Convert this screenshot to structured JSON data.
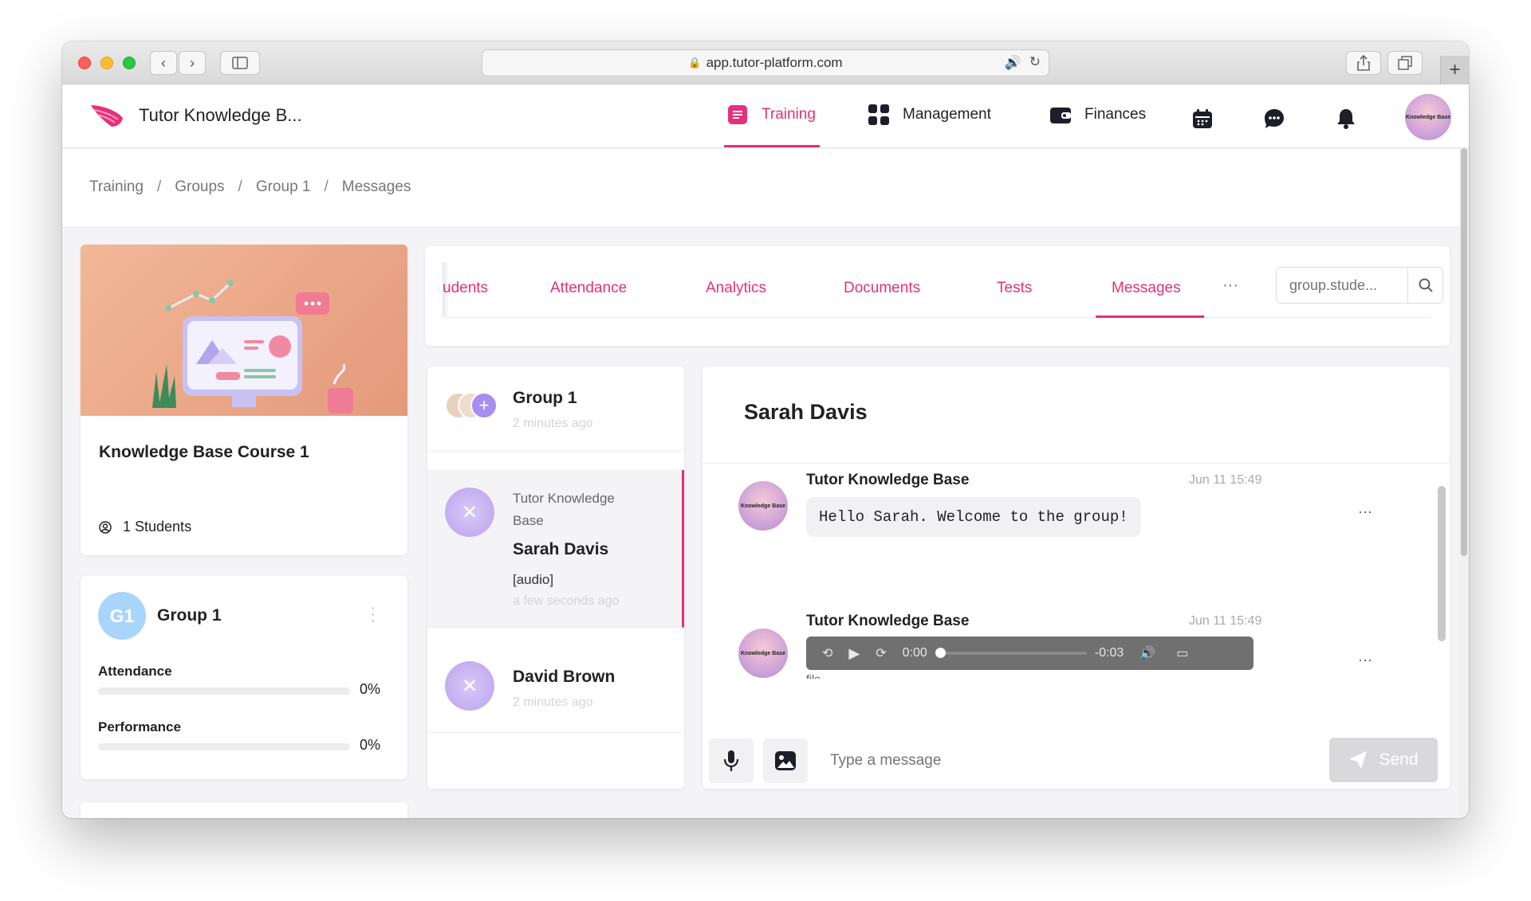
{
  "browser": {
    "url": "app.tutor-platform.com"
  },
  "header": {
    "app_name": "Tutor Knowledge B...",
    "nav": [
      {
        "label": "Training",
        "active": true
      },
      {
        "label": "Management",
        "active": false
      },
      {
        "label": "Finances",
        "active": false
      }
    ],
    "icons": [
      "calendar-icon",
      "chat-icon",
      "bell-icon"
    ],
    "avatar_text": "Knowledge Base"
  },
  "breadcrumb": [
    "Training",
    "Groups",
    "Group 1",
    "Messages"
  ],
  "course": {
    "title": "Knowledge Base Course 1",
    "students": "1 Students"
  },
  "group": {
    "badge": "G1",
    "name": "Group 1",
    "metrics": [
      {
        "label": "Attendance",
        "value": "0%",
        "fraction": 0
      },
      {
        "label": "Performance",
        "value": "0%",
        "fraction": 0
      }
    ]
  },
  "tabs": {
    "items": [
      "udents",
      "Attendance",
      "Analytics",
      "Documents",
      "Tests",
      "Messages"
    ],
    "active": "Messages",
    "more": "···",
    "search_placeholder": "group.stude..."
  },
  "conversations": [
    {
      "name": "Group 1",
      "time": "2 minutes ago",
      "selected": false
    },
    {
      "sender": "Tutor Knowledge Base",
      "name": "Sarah Davis",
      "message": "[audio]",
      "time": "a few seconds ago",
      "selected": true
    },
    {
      "name": "David Brown",
      "time": "2 minutes ago",
      "selected": false
    }
  ],
  "chat": {
    "contact": "Sarah Davis",
    "messages": [
      {
        "sender": "Tutor Knowledge Base",
        "time": "Jun 11 15:49",
        "text": "Hello Sarah. Welcome to the group!",
        "menu": "···"
      },
      {
        "sender": "Tutor Knowledge Base",
        "time": "Jun 11 15:49",
        "audio": {
          "current": "0:00",
          "remaining": "-0:03",
          "progress": 0
        },
        "file_label": "file",
        "menu": "···"
      }
    ],
    "input_placeholder": "Type a message",
    "send_label": "Send"
  },
  "colors": {
    "accent": "#e5307a",
    "badge": "#a9d5fb"
  }
}
